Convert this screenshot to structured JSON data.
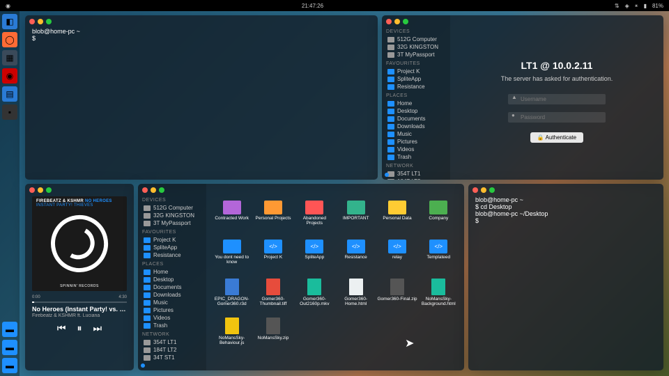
{
  "topbar": {
    "time": "21:47:26",
    "battery": "81%"
  },
  "terminal1": {
    "prompt": "blob@home-pc ~",
    "line2": "$ "
  },
  "terminal2": {
    "l1": "blob@home-pc ~",
    "l2": "$ cd Desktop",
    "l3": "blob@home-pc ~/Desktop",
    "l4": "$ "
  },
  "fm_sidebar": {
    "devices_h": "DEVICES",
    "devices": [
      "512G Computer",
      "32G KINGSTON",
      "3T MyPassport"
    ],
    "fav_h": "FAVOURITES",
    "favourites": [
      "Project K",
      "SpliteApp",
      "Resistance"
    ],
    "places_h": "PLACES",
    "places": [
      "Home",
      "Desktop",
      "Documents",
      "Downloads",
      "Music",
      "Pictures",
      "Videos",
      "Trash"
    ],
    "net_h": "NETWORK",
    "network": [
      "354T LT1",
      "184T LT2",
      "34T ST1"
    ]
  },
  "auth": {
    "title": "LT1 @ 10.0.2.11",
    "message": "The server has asked for authentication.",
    "user_ph": "Username",
    "pass_ph": "Password",
    "button": "Authenticate"
  },
  "music": {
    "header1": "FIREBEATZ & KSHMR",
    "header2": "NO HEROES",
    "header3": "INSTANT PARTY! THIEVES",
    "label": "SPINNIN' RECORDS",
    "elapsed": "0:00",
    "total": "4:30",
    "title": "No Heroes (Instant Party! vs. Pa...",
    "artist": "Firebeatz & KSHMR ft. Luciana"
  },
  "files": {
    "row1": [
      {
        "label": "Contracted Work",
        "cls": "folder f-purple"
      },
      {
        "label": "Personal Projects",
        "cls": "folder f-orange"
      },
      {
        "label": "Abandoned Projects",
        "cls": "folder f-red"
      },
      {
        "label": "IMPORTANT",
        "cls": "folder f-teal"
      },
      {
        "label": "Personal Data",
        "cls": "folder f-yellow"
      },
      {
        "label": "Company",
        "cls": "folder f-green"
      }
    ],
    "row2": [
      {
        "label": "You dont need to know",
        "cls": "folder"
      },
      {
        "label": "Project K",
        "cls": "f-code"
      },
      {
        "label": "SpliteApp",
        "cls": "f-code"
      },
      {
        "label": "Resistance",
        "cls": "f-code"
      },
      {
        "label": "relay",
        "cls": "f-code"
      },
      {
        "label": "Templateed",
        "cls": "f-code"
      }
    ],
    "row3": [
      {
        "label": "EPIC_DRAGON-Gomer360.r3d",
        "cls": "f-doc f-blue"
      },
      {
        "label": "Gomer360-Thumbnail.tiff",
        "cls": "f-doc f-red2"
      },
      {
        "label": "Gomer360-Out2160p.mkv",
        "cls": "f-doc f-teal2"
      },
      {
        "label": "Gomer360-Home.html",
        "cls": "f-doc f-white"
      },
      {
        "label": "Gomer360-Final.zip",
        "cls": "f-doc f-zip"
      },
      {
        "label": "NoMansSky-Background.html",
        "cls": "f-doc f-teal2"
      }
    ],
    "row4": [
      {
        "label": "NoMansSky-Behaviour.js",
        "cls": "f-doc f-js"
      },
      {
        "label": "NoMansSky.zip",
        "cls": "f-doc f-zip"
      }
    ]
  }
}
